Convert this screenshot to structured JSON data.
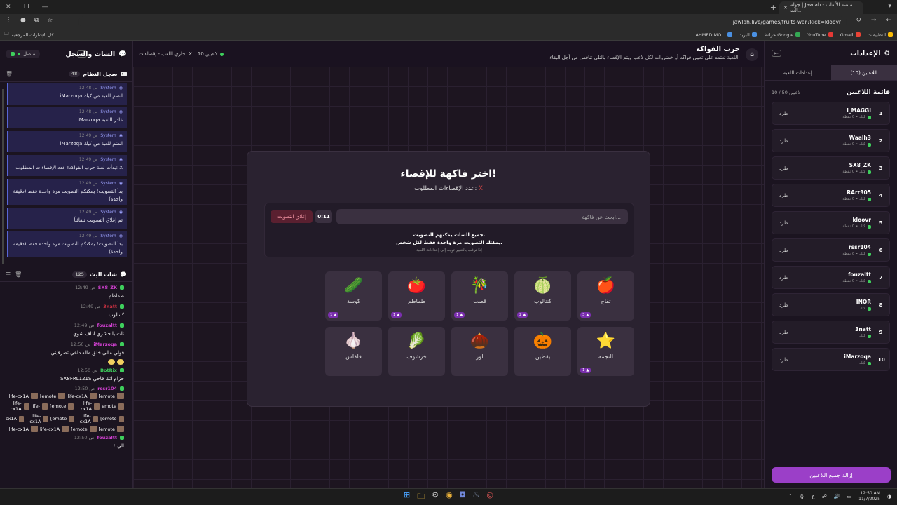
{
  "browser": {
    "tab_title": "جولة | Jawlah - منصة الألعاب الت...",
    "url": "jawlah.live/games/fruits-war?kick=kloovr",
    "bookmarks_left": "كل الإشارات المرجعية",
    "bookmarks": [
      "التطبيقات",
      "Gmail",
      "YouTube",
      "خرائط Google",
      "البريد",
      "AHMED MO..."
    ]
  },
  "left_panel": {
    "title": "الشات والسجل",
    "status": "متصل",
    "system_log": {
      "title": "سجل النظام",
      "count": "48",
      "items": [
        {
          "time": "12:48 ص",
          "text": "iMarzoqa انضم للعبة من كيك"
        },
        {
          "time": "12:48 ص",
          "text": "iMarzoqa غادر اللعبة"
        },
        {
          "time": "12:49 ص",
          "text": "iMarzoqa انضم للعبة من كيك"
        },
        {
          "time": "12:49 ص",
          "text": "بدأت لعبة حرب الفواكه! عدد الإقصاءات المطلوب: X"
        },
        {
          "time": "12:49 ص",
          "text": "بدأ التصويت! يمكنكم التصويت مرة واحدة فقط (دقيقة واحدة)"
        },
        {
          "time": "12:49 ص",
          "text": "تم إغلاق التصويت تلقائياً"
        },
        {
          "time": "12:49 ص",
          "text": "بدأ التصويت! يمكنكم التصويت مرة واحدة فقط (دقيقة واحدة)"
        }
      ],
      "sender": "System"
    },
    "live_chat": {
      "title": "شات البث",
      "count": "125",
      "messages": [
        {
          "user": "SX8_ZK",
          "time": "12:49 ص",
          "text": "طماطم",
          "color": "#d040d0"
        },
        {
          "user": "3natt",
          "time": "12:49 ص",
          "text": "كنتالوب",
          "color": "#c83040"
        },
        {
          "user": "fouzaltt",
          "time": "12:49 ص",
          "text": "نات يا حشري اذاف شوي",
          "color": "#d040d0"
        },
        {
          "user": "iMarzoqa",
          "time": "12:50 ص",
          "text": "قولي مالي خلق ماله داعي تصرفيني",
          "color": "#d040d0"
        },
        {
          "user": "BotRix",
          "time": "12:50 ص",
          "text": "حزام اتك قاحي SX8FRL121S",
          "color": "#3ecf5c"
        },
        {
          "user": "rssr104",
          "time": "12:50 ص",
          "text": "",
          "color": "#d040d0"
        },
        {
          "user": "fouzaltt",
          "time": "12:50 ص",
          "text": "الي!!",
          "color": "#d040d0"
        }
      ],
      "emote_lines": [
        [
          "life-cx1A",
          "[emote",
          "life-cx1A",
          "[emote"
        ],
        [
          "life-cx1A",
          "life-",
          "[emote",
          "life-cx1A",
          "emote"
        ],
        [
          "cx1A",
          "life-cx1A",
          "[emote",
          "life-cx1A",
          "[emote"
        ],
        [
          "life-cx1A",
          "life-cx1A",
          "[emote",
          "[emote"
        ]
      ]
    }
  },
  "header": {
    "title": "حرب الفواكه",
    "subtitle": "اللعبة تعتمد على تعيين فواكه أو خضروات لكل لاعب ويتم الإقصاء بالتلي تنافس من أجل البقاء!",
    "players_count": "10 لاعبين",
    "status": "جاري اللعب - إقصاءات: X"
  },
  "game": {
    "heading": "اختر فاكهة للإقصاء!",
    "needed_label": "عدد الإقصاءات المطلوب:",
    "needed_value": "X",
    "search_placeholder": "ابحث عن فاكهة...",
    "timer": "0:11",
    "close_vote": "إغلاق التصويت",
    "vote_line1": "جميع الشات يمكنهم التصويت.",
    "vote_line2": "يمكنك التصويت مرة واحدة فقط لكل شخص.",
    "vote_hint": "إذا ترغب بالتغيير توجه إلى إعدادات اللعبة",
    "fruits": [
      {
        "name": "تفاح",
        "icon": "🍎",
        "votes": "3"
      },
      {
        "name": "كنتالوب",
        "icon": "🍈",
        "votes": "2"
      },
      {
        "name": "قصب",
        "icon": "🎋",
        "votes": "1"
      },
      {
        "name": "طماطم",
        "icon": "🍅",
        "votes": "1"
      },
      {
        "name": "كوسة",
        "icon": "🥒",
        "votes": "1"
      },
      {
        "name": "النجمة",
        "icon": "⭐",
        "votes": "1"
      },
      {
        "name": "يقطين",
        "icon": "🎃",
        "votes": ""
      },
      {
        "name": "لوز",
        "icon": "🌰",
        "votes": ""
      },
      {
        "name": "خرشوف",
        "icon": "🥬",
        "votes": ""
      },
      {
        "name": "فلفاس",
        "icon": "🧄",
        "votes": ""
      }
    ]
  },
  "right_panel": {
    "title": "الإعدادات",
    "tab_players": "اللاعبين (10)",
    "tab_settings": "إعدادات اللعبة",
    "list_title": "قائمة اللاعبين",
    "list_count": "10 / 50 لاعبين",
    "kick_label": "طرد",
    "players": [
      {
        "num": "1",
        "name": "I_MAGGI",
        "sub": "كيك • 0 نقطة"
      },
      {
        "num": "2",
        "name": "Waalh3",
        "sub": "كيك • 0 نقطة"
      },
      {
        "num": "3",
        "name": "SX8_ZK",
        "sub": "كيك • 0 نقطة"
      },
      {
        "num": "4",
        "name": "RArr305",
        "sub": "كيك • 0 نقطة"
      },
      {
        "num": "5",
        "name": "kloovr",
        "sub": "كيك • 0 نقطة"
      },
      {
        "num": "6",
        "name": "rssr104",
        "sub": "كيك • 0 نقطة"
      },
      {
        "num": "7",
        "name": "fouzaltt",
        "sub": "كيك • 0 نقطة"
      },
      {
        "num": "8",
        "name": "INOR",
        "sub": "كيك"
      },
      {
        "num": "9",
        "name": "3natt",
        "sub": "كيك"
      },
      {
        "num": "10",
        "name": "iMarzoqa",
        "sub": "كيك"
      }
    ],
    "remove_all": "إزالة جميع اللاعبين"
  },
  "taskbar": {
    "time": "12:50 AM",
    "date": "11/7/2025",
    "lang": "ع"
  }
}
